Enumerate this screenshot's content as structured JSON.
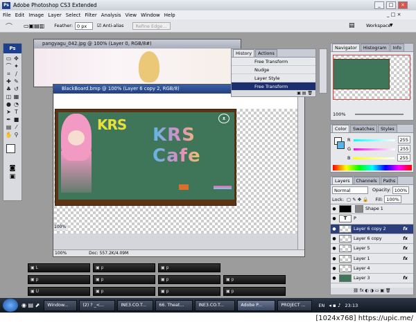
{
  "window": {
    "title": "Adobe Photoshop CS3 Extended",
    "logo": "Ps"
  },
  "menu": [
    "File",
    "Edit",
    "Image",
    "Layer",
    "Select",
    "Filter",
    "Analysis",
    "View",
    "Window",
    "Help"
  ],
  "options": {
    "feather_label": "Feather:",
    "feather_value": "0 px",
    "antialias_label": "Anti-alias",
    "refine_label": "Refine Edge...",
    "workspace_label": "Workspace"
  },
  "toolbox": {
    "badge": "Ps"
  },
  "doc1": {
    "title": "pangyagu_042.jpg @ 100% (Layer 0, RGB/8#)"
  },
  "doc2": {
    "title": "BlackBoard.bmp @ 100% (Layer 6 copy 2, RGB/8)",
    "zoom": "100%",
    "doc_info": "Doc: 557.2K/4.09M",
    "side_zoom": "100%"
  },
  "artwork": {
    "text": "KRS Cafe"
  },
  "history": {
    "tabs": [
      "History",
      "Actions"
    ],
    "items": [
      "Free Transform",
      "Nudge",
      "Layer Style",
      "Free Transform"
    ],
    "selected_index": 3
  },
  "navigator": {
    "tabs": [
      "Navigator",
      "Histogram",
      "Info"
    ],
    "zoom": "100%"
  },
  "color": {
    "tabs": [
      "Color",
      "Swatches",
      "Styles"
    ],
    "channels": [
      {
        "label": "R",
        "value": "255"
      },
      {
        "label": "G",
        "value": "255"
      },
      {
        "label": "B",
        "value": "255"
      }
    ]
  },
  "layers": {
    "tabs": [
      "Layers",
      "Channels",
      "Paths"
    ],
    "blend_mode": "Normal",
    "opacity_label": "Opacity:",
    "opacity": "100%",
    "lock_label": "Lock:",
    "fill_label": "Fill:",
    "fill": "100%",
    "items": [
      {
        "name": "Shape 1",
        "fx": ""
      },
      {
        "name": "P",
        "fx": ""
      },
      {
        "name": "Layer 6 copy 2",
        "fx": "fx"
      },
      {
        "name": "Layer 6 copy",
        "fx": "fx"
      },
      {
        "name": "Layer 5",
        "fx": "fx"
      },
      {
        "name": "Layer 1",
        "fx": "fx"
      },
      {
        "name": "Layer 4",
        "fx": ""
      },
      {
        "name": "Layer 3",
        "fx": "fx"
      }
    ],
    "selected_index": 2
  },
  "taskbar": {
    "tasks": [
      "Window...",
      "(2) ? _<...",
      "INE3.CO.T...",
      "66. Theat...",
      "INE3.CO.T...",
      "Adobe P...",
      "PROJECT ..."
    ],
    "active_index": 5,
    "lang": "EN",
    "time": "23:13"
  },
  "footer": "[1024x768] https://upic.me/",
  "colors": {
    "chalkboard": "#3f7559",
    "board_frame": "#5a3414",
    "accent": "#1c2e6d"
  }
}
